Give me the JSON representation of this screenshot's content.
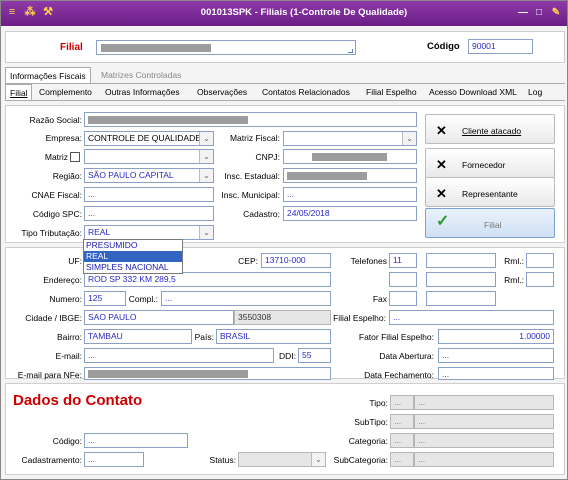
{
  "window": {
    "title": "001013SPK - Filiais (1-Controle De Qualidade)"
  },
  "header": {
    "filial_label": "Filial",
    "codigo_label": "Código",
    "codigo_value": "90001"
  },
  "tabs_top": [
    "Informações Fiscais",
    "Matrizes Controladas"
  ],
  "tabs": [
    "Filial",
    "Complemento",
    "Outras Informações",
    "Observações",
    "Contatos Relacionados",
    "Filial Espelho",
    "Acesso Download XML",
    "Log"
  ],
  "form": {
    "razao_social_label": "Razão Social:",
    "empresa_label": "Empresa:",
    "empresa_value": "CONTROLE DE QUALIDADE",
    "matriz_fiscal_label": "Matriz Fiscal:",
    "matriz_label": "Matriz",
    "cnpj_label": "CNPJ:",
    "regiao_label": "Região:",
    "regiao_value": "SÃO PAULO CAPITAL",
    "insc_estadual_label": "Insc. Estadual:",
    "cnae_label": "CNAE Fiscal:",
    "cnae_value": "...",
    "insc_municipal_label": "Insc. Municipal:",
    "insc_municipal_value": "...",
    "codigo_spc_label": "Código SPC:",
    "codigo_spc_value": "...",
    "cadastro_label": "Cadastro:",
    "cadastro_value": "24/05/2018",
    "tipo_tributacao_label": "Tipo Tributação:",
    "tipo_tributacao_value": "REAL",
    "tipo_tributacao_options": [
      "PRESUMIDO",
      "REAL",
      "SIMPLES NACIONAL"
    ]
  },
  "side_buttons": [
    "Cliente atacado",
    "Fornecedor",
    "Representante",
    "Filial"
  ],
  "address": {
    "uf_label": "UF:",
    "cep_label": "CEP:",
    "cep_value": "13710-000",
    "endereco_label": "Endereço:",
    "endereco_value": "ROD SP 332 KM 289,5",
    "numero_label": "Numero:",
    "numero_value": "125",
    "compl_label": "Compl.:",
    "compl_value": "...",
    "cidade_label": "Cidade / IBGE:",
    "cidade_value": "SAO PAULO",
    "ibge_value": "3550308",
    "bairro_label": "Bairro:",
    "bairro_value": "TAMBAU",
    "pais_label": "País:",
    "pais_value": "BRASIL",
    "email_label": "E-mail:",
    "email_value": "...",
    "ddi_label": "DDI:",
    "ddi_value": "55",
    "email_nfe_label": "E-mail para NFe:"
  },
  "contact_right": {
    "telefones_label": "Telefones",
    "tel_ddd": "11",
    "rml_label": "Rml.:",
    "fax_label": "Fax",
    "filial_espelho_label": "Filial Espelho:",
    "filial_espelho_value": "...",
    "fator_label": "Fator Filial Espelho:",
    "fator_value": "1.00000",
    "data_abertura_label": "Data Abertura:",
    "data_abertura_value": "...",
    "data_fechamento_label": "Data Fechamento:",
    "data_fechamento_value": "..."
  },
  "contato": {
    "title": "Dados do Contato",
    "codigo_label": "Código:",
    "codigo_value": "...",
    "cadastramento_label": "Cadastramento:",
    "cadastramento_value": "...",
    "status_label": "Status:",
    "tipo_label": "Tipo:",
    "subtipo_label": "SubTipo:",
    "categoria_label": "Categoria:",
    "subcategoria_label": "SubCategoria:",
    "dots": "..."
  },
  "colors": {
    "title_bar": "#7a2a96",
    "label_red": "#cc0000",
    "value_blue": "#2a2ac9",
    "highlight": "#3364c2"
  }
}
